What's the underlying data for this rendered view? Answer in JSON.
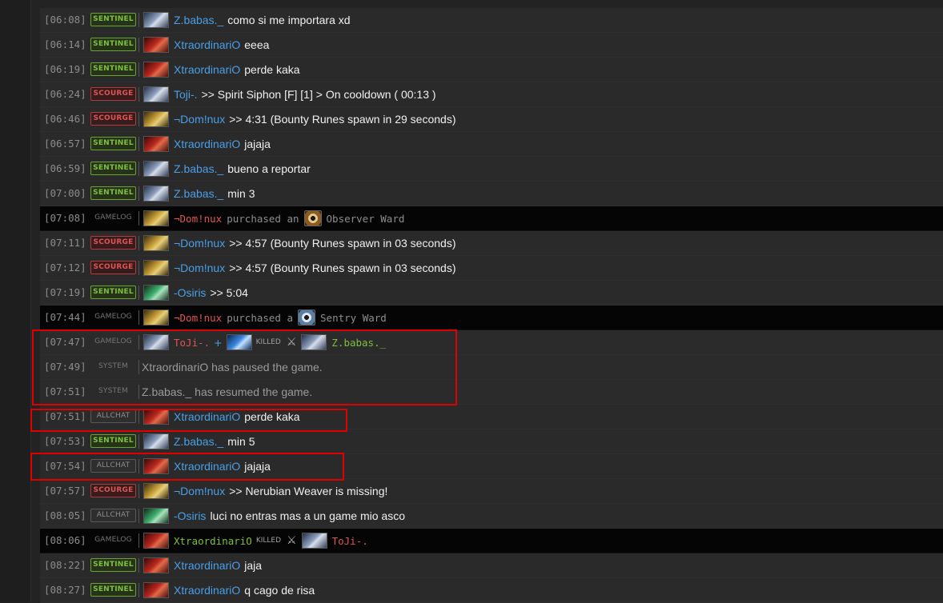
{
  "colors": {
    "background": "#232323",
    "row": "#2a2a2a",
    "gamelog_row": "#050505",
    "sentinel": "#7dc03e",
    "scourge": "#e15353",
    "player_name": "#4a9fe8",
    "highlight_box": "#e00000"
  },
  "rows": [
    {
      "time": "[06:08]",
      "tag": "SENTINEL",
      "avatar": "zbabas-hero-icon",
      "name": "Z.babas._",
      "text": "como si me importara xd"
    },
    {
      "time": "[06:14]",
      "tag": "SENTINEL",
      "avatar": "xtraordinario-hero-icon",
      "name": "XtraordinariO",
      "text": "eeea"
    },
    {
      "time": "[06:19]",
      "tag": "SENTINEL",
      "avatar": "xtraordinario-hero-icon",
      "name": "XtraordinariO",
      "text": "perde kaka"
    },
    {
      "time": "[06:24]",
      "tag": "SCOURGE",
      "avatar": "toji-hero-icon",
      "name": "Toji-.",
      "text": ">> Spirit Siphon [F] [1] > On cooldown ( 00:13 )"
    },
    {
      "time": "[06:46]",
      "tag": "SCOURGE",
      "avatar": "dominux-hero-icon",
      "name": "¬Dom!nux",
      "text": ">> 4:31 (Bounty Runes spawn in 29 seconds)"
    },
    {
      "time": "[06:57]",
      "tag": "SENTINEL",
      "avatar": "xtraordinario-hero-icon",
      "name": "XtraordinariO",
      "text": "jajaja"
    },
    {
      "time": "[06:59]",
      "tag": "SENTINEL",
      "avatar": "zbabas-hero-icon",
      "name": "Z.babas._",
      "text": "bueno a reportar"
    },
    {
      "time": "[07:00]",
      "tag": "SENTINEL",
      "avatar": "zbabas-hero-icon",
      "name": "Z.babas._",
      "text": "min 3"
    },
    {
      "time": "[07:08]",
      "tag": "GAMELOG",
      "avatar": "dominux-hero-icon",
      "actor": "¬Dom!nux",
      "verb": "purchased an",
      "item_icon": "observer-ward-icon",
      "item": "Observer Ward"
    },
    {
      "time": "[07:11]",
      "tag": "SCOURGE",
      "avatar": "dominux-hero-icon",
      "name": "¬Dom!nux",
      "text": ">> 4:57 (Bounty Runes spawn in 03 seconds)"
    },
    {
      "time": "[07:12]",
      "tag": "SCOURGE",
      "avatar": "dominux-hero-icon",
      "name": "¬Dom!nux",
      "text": ">> 4:57 (Bounty Runes spawn in 03 seconds)"
    },
    {
      "time": "[07:19]",
      "tag": "SENTINEL",
      "avatar": "osiris-hero-icon",
      "name": "-Osiris",
      "text": ">> 5:04"
    },
    {
      "time": "[07:44]",
      "tag": "GAMELOG",
      "avatar": "dominux-hero-icon",
      "actor": "¬Dom!nux",
      "verb": "purchased a",
      "item_icon": "sentry-ward-icon",
      "item": "Sentry Ward"
    },
    {
      "time": "[07:47]",
      "tag": "GAMELOG",
      "kill": true,
      "killer": "ToJi-.",
      "plus": "+",
      "killed": "KILLED",
      "victim": "Z.babas._"
    },
    {
      "time": "[07:49]",
      "tag": "SYSTEM",
      "text": "XtraordinariO has paused the game."
    },
    {
      "time": "[07:51]",
      "tag": "SYSTEM",
      "text": "Z.babas._ has resumed the game."
    },
    {
      "time": "[07:51]",
      "tag": "ALLCHAT",
      "avatar": "xtraordinario-hero-icon",
      "name": "XtraordinariO",
      "text": "perde kaka"
    },
    {
      "time": "[07:53]",
      "tag": "SENTINEL",
      "avatar": "zbabas-hero-icon",
      "name": "Z.babas._",
      "text": "min 5"
    },
    {
      "time": "[07:54]",
      "tag": "ALLCHAT",
      "avatar": "xtraordinario-hero-icon",
      "name": "XtraordinariO",
      "text": "jajaja"
    },
    {
      "time": "[07:57]",
      "tag": "SCOURGE",
      "avatar": "dominux-hero-icon",
      "name": "¬Dom!nux",
      "text": ">> Nerubian Weaver is missing!"
    },
    {
      "time": "[08:05]",
      "tag": "ALLCHAT",
      "avatar": "osiris-hero-icon",
      "name": "-Osiris",
      "text": "luci no entras mas a un game mio asco"
    },
    {
      "time": "[08:06]",
      "tag": "GAMELOG",
      "kill": true,
      "killer": "XtraordinariO",
      "killed": "KILLED",
      "victim": "ToJi-."
    },
    {
      "time": "[08:22]",
      "tag": "SENTINEL",
      "avatar": "xtraordinario-hero-icon",
      "name": "XtraordinariO",
      "text": "jaja"
    },
    {
      "time": "[08:27]",
      "tag": "SENTINEL",
      "avatar": "xtraordinario-hero-icon",
      "name": "XtraordinariO",
      "text": "q cago de risa"
    }
  ]
}
